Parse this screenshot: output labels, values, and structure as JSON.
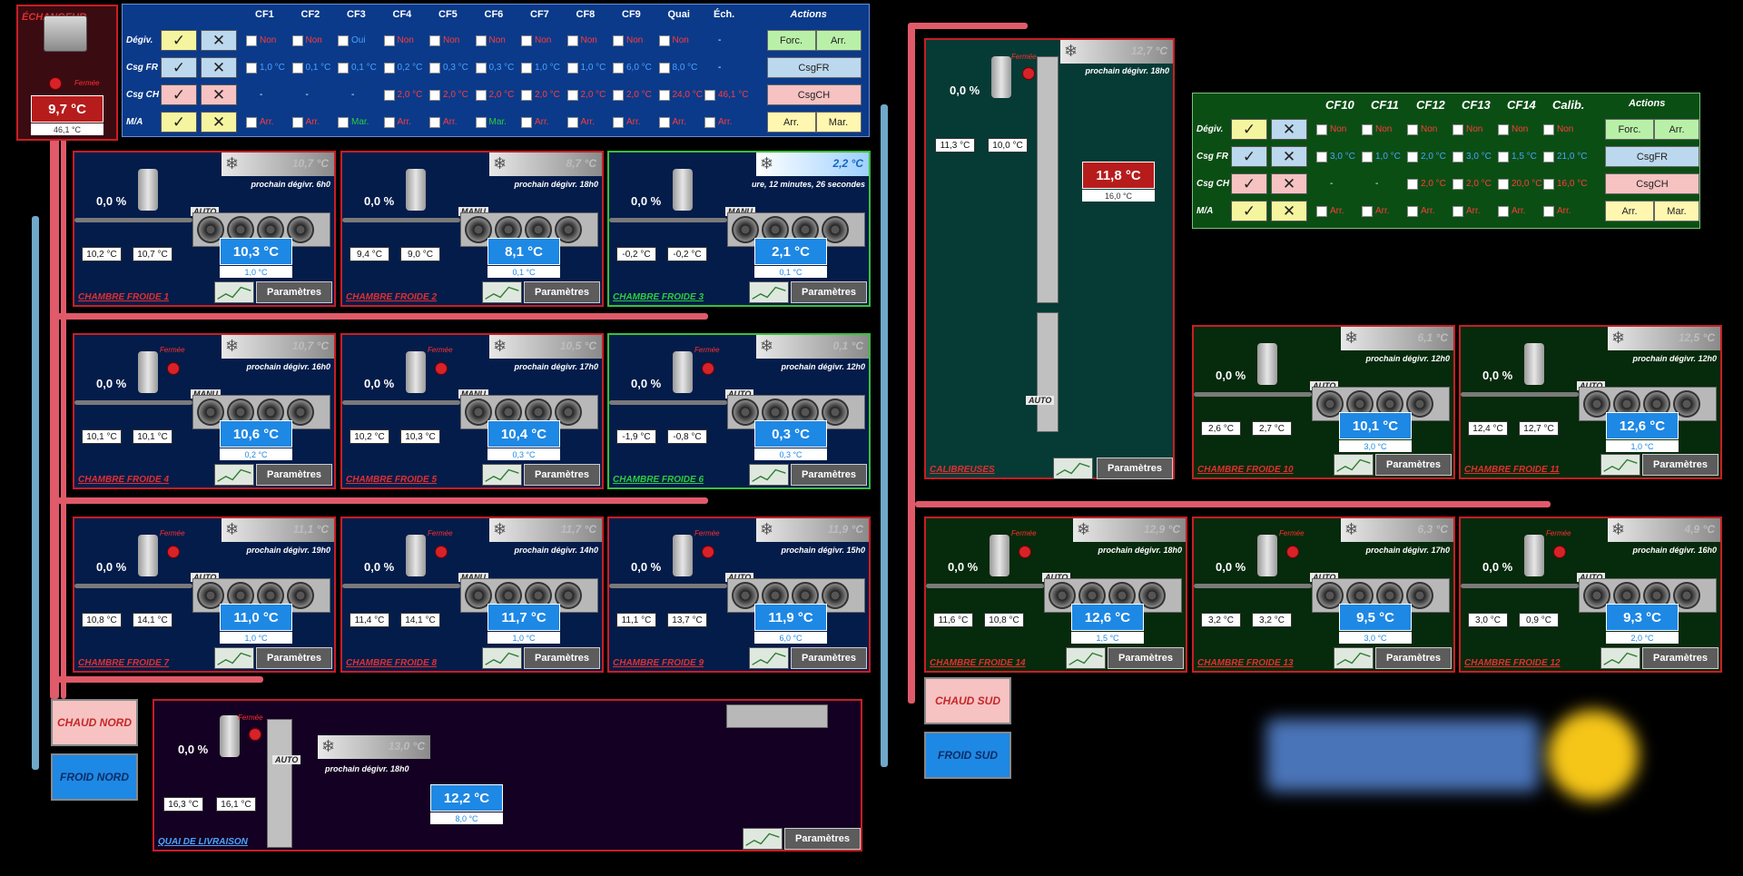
{
  "exchanger": {
    "vertical_label": "ÉCHANGEUR",
    "valve_status": "Fermée",
    "temp": "9,7 °C",
    "sub_temp": "46,1 °C"
  },
  "table1": {
    "headers": [
      "CF1",
      "CF2",
      "CF3",
      "CF4",
      "CF5",
      "CF6",
      "CF7",
      "CF8",
      "CF9",
      "Quai",
      "Éch."
    ],
    "actions_header": "Actions",
    "rows": [
      {
        "label": "Dégiv.",
        "cells": [
          "Non",
          "Non",
          "Oui",
          "Non",
          "Non",
          "Non",
          "Non",
          "Non",
          "Non",
          "Non",
          "-"
        ]
      },
      {
        "label": "Csg FR",
        "cells": [
          "1,0 °C",
          "0,1 °C",
          "0,1 °C",
          "0,2 °C",
          "0,3 °C",
          "0,3 °C",
          "1,0 °C",
          "1,0 °C",
          "6,0 °C",
          "8,0 °C",
          "-"
        ]
      },
      {
        "label": "Csg CH",
        "cells": [
          "-",
          "-",
          "-",
          "2,0 °C",
          "2,0 °C",
          "2,0 °C",
          "2,0 °C",
          "2,0 °C",
          "2,0 °C",
          "24,0 °C",
          "46,1 °C"
        ]
      },
      {
        "label": "M/A",
        "cells": [
          "Arr.",
          "Arr.",
          "Mar.",
          "Arr.",
          "Arr.",
          "Mar.",
          "Arr.",
          "Arr.",
          "Arr.",
          "Arr.",
          "Arr."
        ]
      }
    ],
    "action_buttons": {
      "forc": "Forc.",
      "arr": "Arr.",
      "csgfr": "CsgFR",
      "csgch": "CsgCH",
      "arr2": "Arr.",
      "mar": "Mar."
    }
  },
  "table2": {
    "headers": [
      "CF10",
      "CF11",
      "CF12",
      "CF13",
      "CF14",
      "Calib."
    ],
    "actions_header": "Actions",
    "rows": [
      {
        "label": "Dégiv.",
        "cells": [
          "Non",
          "Non",
          "Non",
          "Non",
          "Non",
          "Non"
        ]
      },
      {
        "label": "Csg FR",
        "cells": [
          "3,0 °C",
          "1,0 °C",
          "2,0 °C",
          "3,0 °C",
          "1,5 °C",
          "21,0 °C"
        ]
      },
      {
        "label": "Csg CH",
        "cells": [
          "-",
          "-",
          "2,0 °C",
          "2,0 °C",
          "20,0 °C",
          "16,0 °C"
        ]
      },
      {
        "label": "M/A",
        "cells": [
          "Arr.",
          "Arr.",
          "Arr.",
          "Arr.",
          "Arr.",
          "Arr."
        ]
      }
    ],
    "action_buttons": {
      "forc": "Forc.",
      "arr": "Arr.",
      "csgfr": "CsgFR",
      "csgch": "CsgCH",
      "arr2": "Arr.",
      "mar": "Mar."
    }
  },
  "common": {
    "valve_status": "Fermée",
    "params": "Paramètres",
    "pct": "0,0 %"
  },
  "rooms": [
    {
      "name": "CHAMBRE FROIDE 1",
      "defrost": "10,7 °C",
      "next": "prochain dégivr. 6h0",
      "mode": "AUTO",
      "t1": "10,2 °C",
      "t2": "10,7 °C",
      "temp": "10,3 °C",
      "set": "1,0 °C"
    },
    {
      "name": "CHAMBRE FROIDE 2",
      "defrost": "8,7 °C",
      "next": "prochain dégivr. 18h0",
      "mode": "MANU",
      "t1": "9,4 °C",
      "t2": "9,0 °C",
      "temp": "8,1 °C",
      "set": "0,1 °C"
    },
    {
      "name": "CHAMBRE FROIDE 3",
      "defrost": "2,2 °C",
      "next": "ure, 12 minutes, 26 secondes",
      "mode": "MANU",
      "t1": "-0,2 °C",
      "t2": "-0,2 °C",
      "temp": "2,1 °C",
      "set": "0,1 °C"
    },
    {
      "name": "CHAMBRE FROIDE 4",
      "defrost": "10,7 °C",
      "next": "prochain dégivr. 16h0",
      "mode": "MANU",
      "t1": "10,1 °C",
      "t2": "10,1 °C",
      "temp": "10,6 °C",
      "set": "0,2 °C"
    },
    {
      "name": "CHAMBRE FROIDE 5",
      "defrost": "10,5 °C",
      "next": "prochain dégivr. 17h0",
      "mode": "MANU",
      "t1": "10,2 °C",
      "t2": "10,3 °C",
      "temp": "10,4 °C",
      "set": "0,3 °C"
    },
    {
      "name": "CHAMBRE FROIDE 6",
      "defrost": "0,1 °C",
      "next": "prochain dégivr. 12h0",
      "mode": "AUTO",
      "t1": "-1,9 °C",
      "t2": "-0,8 °C",
      "temp": "0,3 °C",
      "set": "0,3 °C"
    },
    {
      "name": "CHAMBRE FROIDE 7",
      "defrost": "11,1 °C",
      "next": "prochain dégivr. 19h0",
      "mode": "AUTO",
      "t1": "10,8 °C",
      "t2": "14,1 °C",
      "temp": "11,0 °C",
      "set": "1,0 °C"
    },
    {
      "name": "CHAMBRE FROIDE 8",
      "defrost": "11,7 °C",
      "next": "prochain dégivr. 14h0",
      "mode": "MANU",
      "t1": "11,4 °C",
      "t2": "14,1 °C",
      "temp": "11,7 °C",
      "set": "1,0 °C"
    },
    {
      "name": "CHAMBRE FROIDE 9",
      "defrost": "11,9 °C",
      "next": "prochain dégivr. 15h0",
      "mode": "AUTO",
      "t1": "11,1 °C",
      "t2": "13,7 °C",
      "temp": "11,9 °C",
      "set": "6,0 °C"
    },
    {
      "name": "CHAMBRE FROIDE 10",
      "defrost": "6,1 °C",
      "next": "prochain dégivr. 12h0",
      "mode": "AUTO",
      "t1": "2,6 °C",
      "t2": "2,7 °C",
      "temp": "10,1 °C",
      "set": "3,0 °C"
    },
    {
      "name": "CHAMBRE FROIDE 11",
      "defrost": "12,5 °C",
      "next": "prochain dégivr. 12h0",
      "mode": "AUTO",
      "t1": "12,4 °C",
      "t2": "12,7 °C",
      "temp": "12,6 °C",
      "set": "1,0 °C"
    },
    {
      "name": "CHAMBRE FROIDE 14",
      "defrost": "12,9 °C",
      "next": "prochain dégivr. 18h0",
      "mode": "AUTO",
      "t1": "11,6 °C",
      "t2": "10,8 °C",
      "temp": "12,6 °C",
      "set": "1,5 °C"
    },
    {
      "name": "CHAMBRE FROIDE 13",
      "defrost": "6,3 °C",
      "next": "prochain dégivr. 17h0",
      "mode": "AUTO",
      "t1": "3,2 °C",
      "t2": "3,2 °C",
      "temp": "9,5 °C",
      "set": "3,0 °C"
    },
    {
      "name": "CHAMBRE FROIDE 12",
      "defrost": "4,9 °C",
      "next": "prochain dégivr. 16h0",
      "mode": "AUTO",
      "t1": "3,0 °C",
      "t2": "0,9 °C",
      "temp": "9,3 °C",
      "set": "2,0 °C"
    }
  ],
  "calibreuses": {
    "name": "CALIBREUSES",
    "defrost": "12,7 °C",
    "next": "prochain dégivr. 18h0",
    "t1": "11,3 °C",
    "t2": "10,0 °C",
    "temp": "11,8 °C",
    "set": "16,0 °C",
    "mode": "AUTO"
  },
  "quai": {
    "name": "QUAI DE LIVRAISON",
    "defrost": "13,0 °C",
    "next": "prochain dégivr. 18h0",
    "mode": "AUTO",
    "t1": "16,3 °C",
    "t2": "16,1 °C",
    "temp": "12,2 °C",
    "set": "8,0 °C"
  },
  "buttons": {
    "chaud_nord": "CHAUD NORD",
    "froid_nord": "FROID NORD",
    "chaud_sud": "CHAUD SUD",
    "froid_sud": "FROID SUD"
  }
}
